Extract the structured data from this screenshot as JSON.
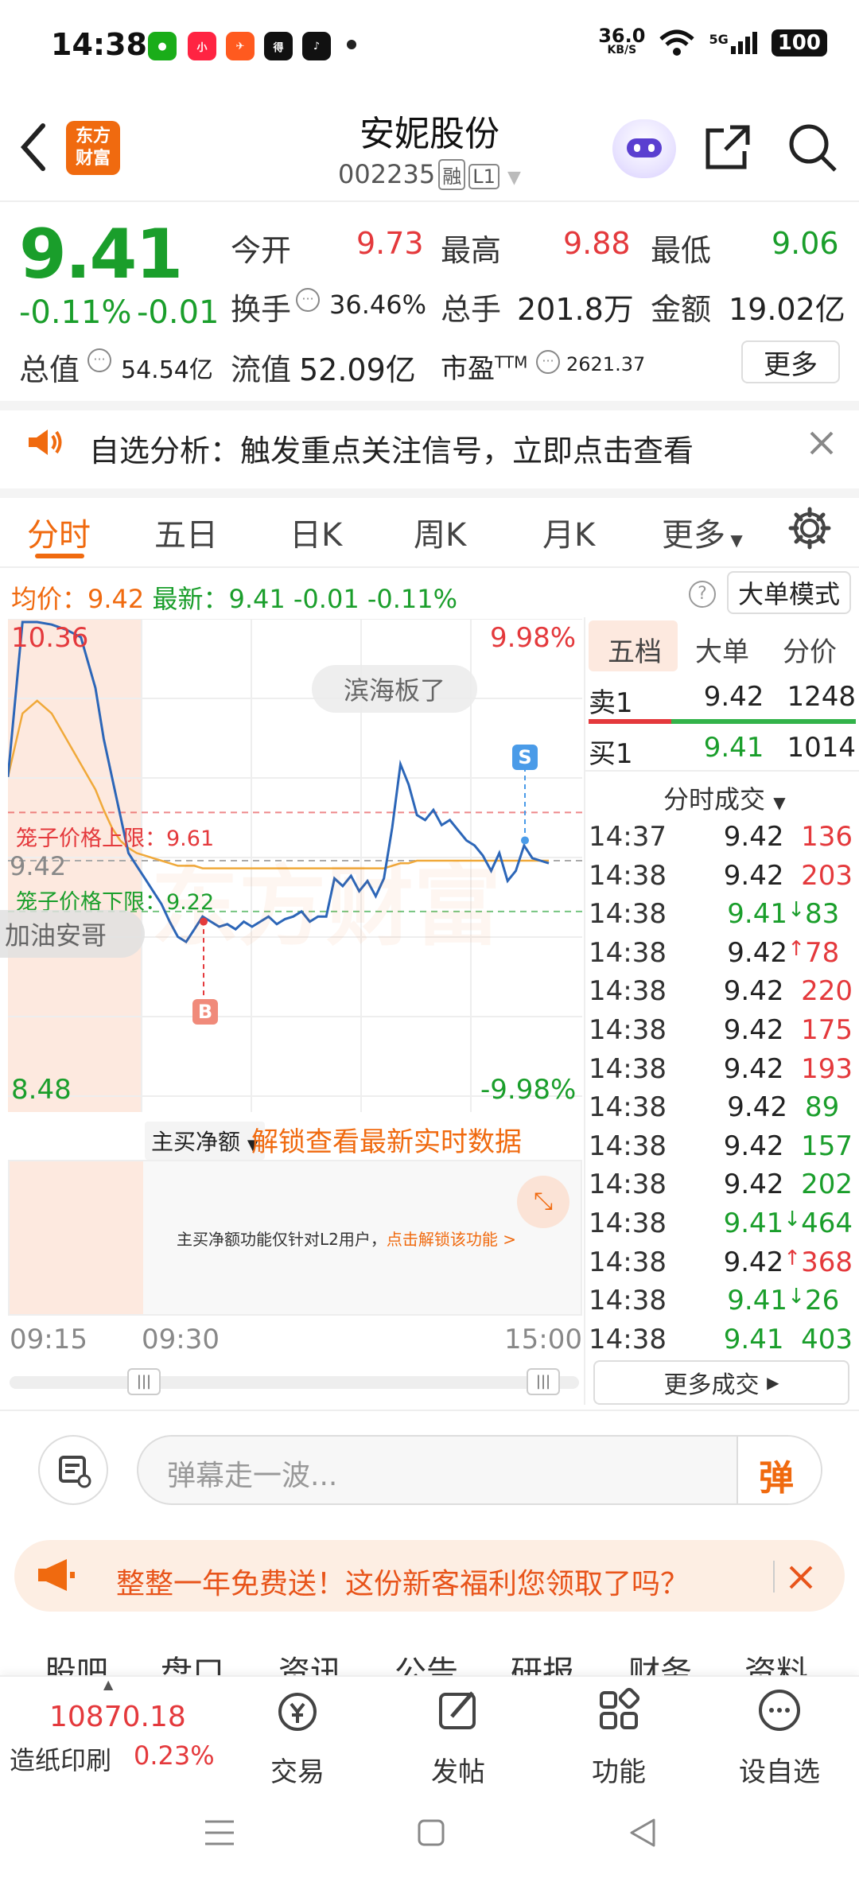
{
  "status_bar": {
    "time": "14:38",
    "apps": [
      "微信",
      "小红书",
      "飞书",
      "得物",
      "抖音"
    ],
    "network_speed": "36.0",
    "network_unit": "KB/S",
    "signal": "5G",
    "battery": "100"
  },
  "header": {
    "logo_line1": "东方",
    "logo_line2": "财富",
    "stock_name": "安妮股份",
    "stock_code": "002235",
    "badge_margin": "融",
    "badge_level": "L1"
  },
  "quote": {
    "price": "9.41",
    "change_pct": "-0.11%",
    "change_amt": "-0.01",
    "open_label": "今开",
    "open": "9.73",
    "high_label": "最高",
    "high": "9.88",
    "low_label": "最低",
    "low": "9.06",
    "turnover_label": "换手",
    "turnover": "36.46%",
    "volume_label": "总手",
    "volume": "201.8万",
    "amount_label": "金额",
    "amount": "19.02亿",
    "mktcap_label": "总值",
    "mktcap": "54.54亿",
    "float_label": "流值",
    "float": "52.09亿",
    "pe_label": "市盈",
    "pe_sup": "TTM",
    "pe": "2621.37",
    "more_button": "更多"
  },
  "banner": {
    "text": "自选分析：触发重点关注信号，立即点击查看"
  },
  "tabs": [
    {
      "label": "分时"
    },
    {
      "label": "五日"
    },
    {
      "label": "日K"
    },
    {
      "label": "周K"
    },
    {
      "label": "月K"
    },
    {
      "label": "更多"
    }
  ],
  "info_line": {
    "avg_label": "均价：",
    "avg": "9.42",
    "latest_label": "最新：",
    "latest": "9.41",
    "change": "-0.01",
    "change_pct": "-0.11%",
    "help": "?",
    "big_order_mode": "大单模式"
  },
  "chart": {
    "top_price": "10.36",
    "top_pct": "9.98%",
    "bottom_price": "8.48",
    "bottom_pct": "-9.98%",
    "mid_price": "9.42",
    "cage_upper": "笼子价格上限：9.61",
    "cage_lower": "笼子价格下限：9.22",
    "watermark": "东方财富",
    "bullet_bubble": "滨海板了",
    "bullet_left": "加油安哥",
    "marker_buy": "B",
    "marker_sell": "S",
    "indicator_select": "主买净额",
    "unlock_text": "解锁查看最新实时数据",
    "l2_note": "主买净额功能仅针对L2用户，",
    "l2_link": "点击解锁该功能 >",
    "time_start": "09:15",
    "time_mid": "09:30",
    "time_end": "15:00"
  },
  "chart_data": {
    "type": "line",
    "title": "",
    "ylim": [
      8.48,
      10.36
    ],
    "series": [
      {
        "name": "",
        "values": [
          9.75,
          10.36,
          10.36,
          10.35,
          10.33,
          10.3,
          10.1,
          9.9,
          9.75,
          9.6,
          9.45,
          9.4,
          9.35,
          9.3,
          9.25,
          9.18,
          9.12,
          9.1,
          9.15,
          9.2,
          9.18,
          9.16,
          9.17,
          9.15,
          9.18,
          9.16,
          9.18,
          9.2,
          9.17,
          9.19,
          9.2,
          9.22,
          9.18,
          9.2,
          9.2,
          9.35,
          9.32,
          9.36,
          9.3,
          9.34,
          9.28,
          9.35,
          9.55,
          9.8,
          9.72,
          9.6,
          9.58,
          9.62,
          9.56,
          9.58,
          9.54,
          9.5,
          9.48,
          9.44,
          9.38,
          9.45,
          9.34,
          9.38,
          9.48,
          9.43,
          9.42,
          9.41
        ]
      },
      {
        "name": "均价",
        "values": [
          9.75,
          10.0,
          10.05,
          10.0,
          9.9,
          9.8,
          9.7,
          9.62,
          9.55,
          9.5,
          9.47,
          9.45,
          9.44,
          9.43,
          9.42,
          9.41,
          9.4,
          9.4,
          9.4,
          9.39,
          9.39,
          9.39,
          9.39,
          9.39,
          9.39,
          9.39,
          9.39,
          9.39,
          9.39,
          9.39,
          9.39,
          9.39,
          9.39,
          9.39,
          9.39,
          9.39,
          9.39,
          9.39,
          9.39,
          9.39,
          9.39,
          9.39,
          9.4,
          9.41,
          9.41,
          9.42,
          9.42,
          9.42,
          9.42,
          9.42,
          9.42,
          9.42,
          9.42,
          9.42,
          9.42,
          9.42,
          9.42,
          9.42,
          9.42,
          9.42,
          9.42,
          9.42
        ]
      }
    ]
  },
  "order_book": {
    "tabs": [
      "五档",
      "大单",
      "分价"
    ],
    "sell1": {
      "label": "卖1",
      "price": "9.42",
      "vol": "1248"
    },
    "buy1": {
      "label": "买1",
      "price": "9.41",
      "vol": "1014"
    },
    "trades_title": "分时成交",
    "trades": [
      {
        "t": "14:37",
        "p": "9.42",
        "v": "136",
        "c": "red",
        "a": ""
      },
      {
        "t": "14:38",
        "p": "9.42",
        "v": "203",
        "c": "red",
        "a": ""
      },
      {
        "t": "14:38",
        "p": "9.41",
        "v": "83",
        "c": "green",
        "a": "↓"
      },
      {
        "t": "14:38",
        "p": "9.42",
        "v": "78",
        "c": "red",
        "a": "↑"
      },
      {
        "t": "14:38",
        "p": "9.42",
        "v": "220",
        "c": "red",
        "a": ""
      },
      {
        "t": "14:38",
        "p": "9.42",
        "v": "175",
        "c": "red",
        "a": ""
      },
      {
        "t": "14:38",
        "p": "9.42",
        "v": "193",
        "c": "red",
        "a": ""
      },
      {
        "t": "14:38",
        "p": "9.42",
        "v": "89",
        "c": "green",
        "a": ""
      },
      {
        "t": "14:38",
        "p": "9.42",
        "v": "157",
        "c": "green",
        "a": ""
      },
      {
        "t": "14:38",
        "p": "9.42",
        "v": "202",
        "c": "green",
        "a": ""
      },
      {
        "t": "14:38",
        "p": "9.41",
        "v": "464",
        "c": "green",
        "a": "↓"
      },
      {
        "t": "14:38",
        "p": "9.42",
        "v": "368",
        "c": "red",
        "a": "↑"
      },
      {
        "t": "14:38",
        "p": "9.41",
        "v": "26",
        "c": "green",
        "a": "↓"
      },
      {
        "t": "14:38",
        "p": "9.41",
        "v": "403",
        "c": "green",
        "a": ""
      }
    ],
    "more_trades": "更多成交"
  },
  "comment_bar": {
    "placeholder": "弹幕走一波...",
    "send": "弹"
  },
  "promo": {
    "text": "整整一年免费送！这份新客福利您领取了吗？"
  },
  "sub_tabs": [
    "股吧",
    "盘口",
    "资讯",
    "公告",
    "研报",
    "财务",
    "资料"
  ],
  "bottom_nav": {
    "index_value": "10870.18",
    "index_name": "造纸印刷",
    "index_pct": "0.23%",
    "items": [
      "交易",
      "发帖",
      "功能",
      "设自选"
    ]
  },
  "colors": {
    "up": "#e4393c",
    "down": "#1a9e2b",
    "accent": "#f06a0f"
  }
}
